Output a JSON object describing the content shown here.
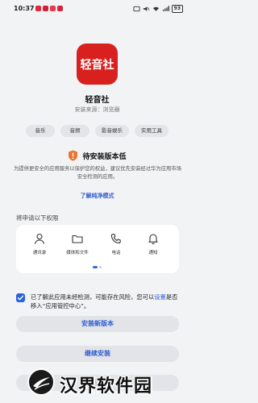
{
  "status_bar": {
    "time": "10:37",
    "battery": "93",
    "app_icon_colors": [
      "#e0283a",
      "#d11f3a",
      "#e33b4b",
      "#d4253f"
    ]
  },
  "app": {
    "icon_text": "轻音社",
    "name": "轻音社",
    "source": "安装来源：浏览器",
    "brand_color": "#d8201f"
  },
  "tags": [
    "音乐",
    "音频",
    "影音娱乐",
    "实用工具"
  ],
  "warning": {
    "title": "待安装版本低",
    "description": "为提供更安全的应用服务以保护您的权益，建议优先安装经过华为应用市场安全检测的应用。",
    "link": "了解纯净模式",
    "icon": "shield-warning-icon",
    "icon_color": "#e8772e"
  },
  "permissions": {
    "heading": "将申请以下权限",
    "items": [
      {
        "label": "通讯录",
        "icon": "contacts-icon"
      },
      {
        "label": "媒体和文件",
        "icon": "folder-icon"
      },
      {
        "label": "电话",
        "icon": "phone-icon"
      },
      {
        "label": "通知",
        "icon": "bell-icon"
      }
    ]
  },
  "consent": {
    "checked": true,
    "text_before": "已了解此应用未经检测，可能存在风险，您可以",
    "link": "设置",
    "text_after": "是否移入“应用管控中心”。"
  },
  "buttons": {
    "install_new": "安装新版本",
    "continue": "继续安装",
    "cancel": "取消"
  },
  "watermark": {
    "text": "汉界软件园"
  },
  "colors": {
    "accent": "#2f5ccf",
    "background": "#f1f3f5",
    "button_bg": "#e2e4e8"
  }
}
